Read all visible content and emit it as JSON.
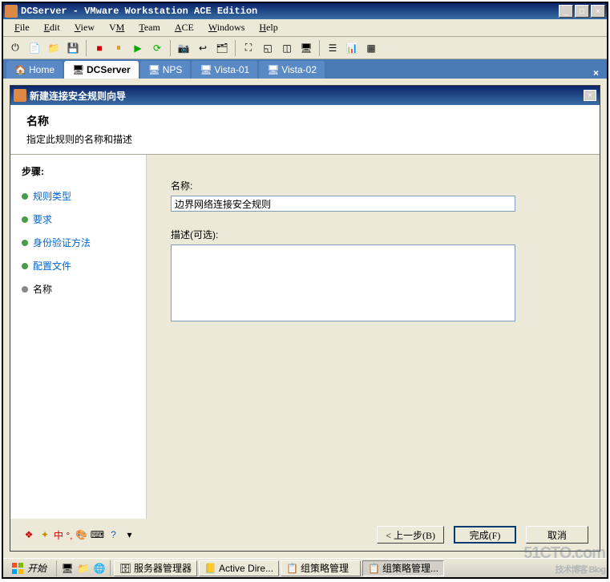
{
  "window": {
    "title": "DCServer - VMware Workstation ACE Edition",
    "min": "_",
    "max": "□",
    "close": "×"
  },
  "menu": {
    "file": "File",
    "edit": "Edit",
    "view": "View",
    "vm": "VM",
    "team": "Team",
    "ace": "ACE",
    "windows": "Windows",
    "help": "Help"
  },
  "tabs": {
    "home": "Home",
    "dcserver": "DCServer",
    "nps": "NPS",
    "vista01": "Vista-01",
    "vista02": "Vista-02",
    "close": "×"
  },
  "wizard": {
    "title": "新建连接安全规则向导",
    "close": "×",
    "header_title": "名称",
    "header_desc": "指定此规则的名称和描述",
    "steps_title": "步骤:",
    "steps": {
      "s1": "规则类型",
      "s2": "要求",
      "s3": "身份验证方法",
      "s4": "配置文件",
      "s5": "名称"
    },
    "name_label": "名称:",
    "name_value": "边界网络连接安全规则",
    "desc_label": "描述(可选):",
    "desc_value": "",
    "status_text": "中 °,",
    "btn_back": "< 上一步(B)",
    "btn_finish": "完成(F)",
    "btn_cancel": "取消"
  },
  "taskbar": {
    "start": "开始",
    "tasks": {
      "t1": "服务器管理器",
      "t2": "Active Dire...",
      "t3": "组策略管理",
      "t4": "组策略管理..."
    }
  },
  "watermark": {
    "main": "51CTO.com",
    "sub": "技术博客 Blog"
  }
}
